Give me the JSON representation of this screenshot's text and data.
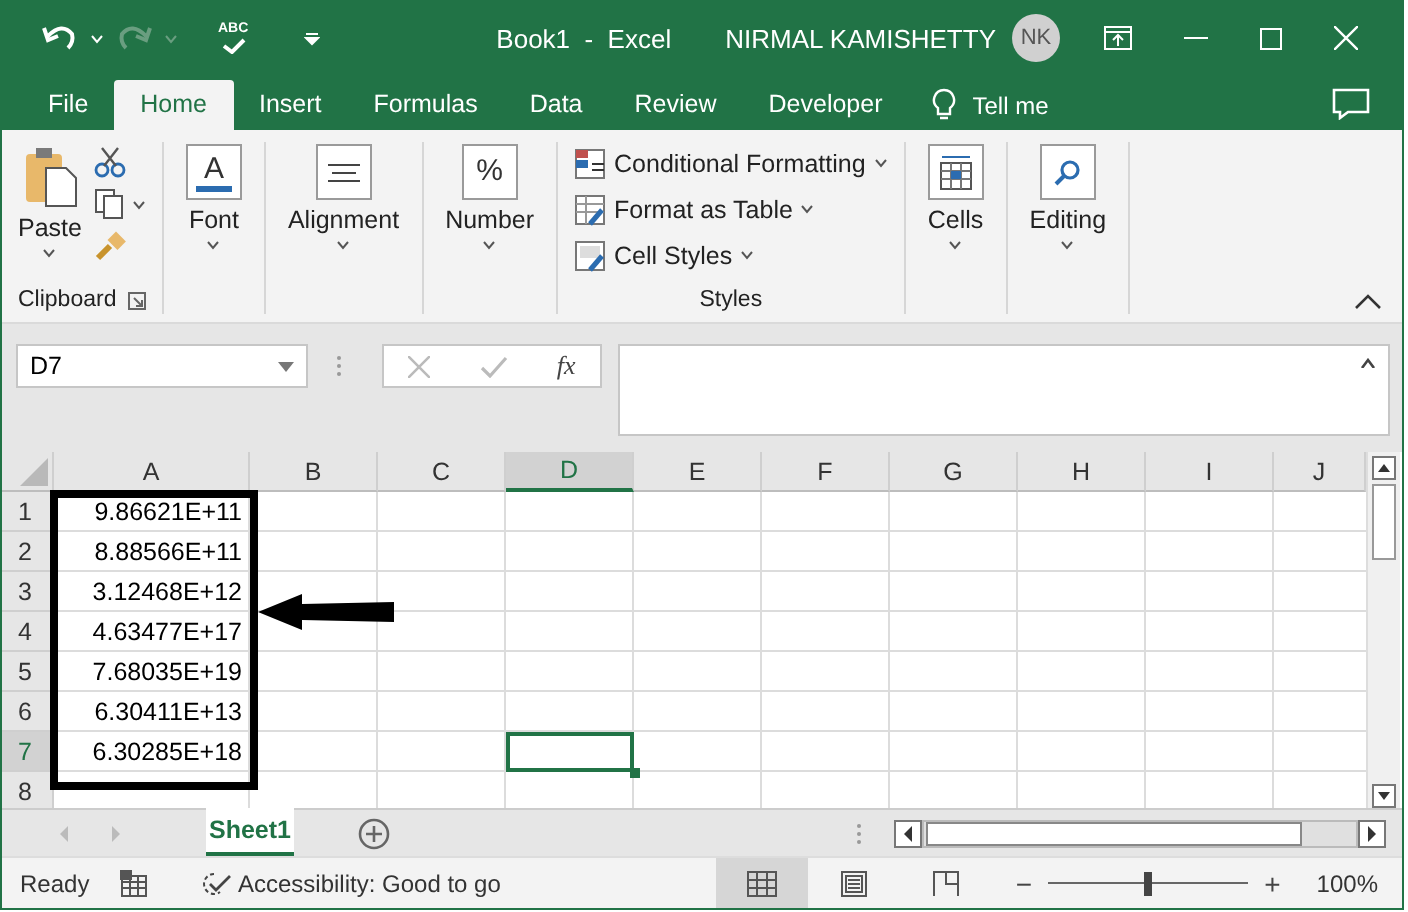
{
  "window": {
    "title": "Book1  -  Excel",
    "user": "NIRMAL KAMISHETTY",
    "avatar_initials": "NK"
  },
  "quick_access": {
    "spelling_label": "ABC"
  },
  "tabs": [
    {
      "label": "File",
      "selected": false
    },
    {
      "label": "Home",
      "selected": true
    },
    {
      "label": "Insert",
      "selected": false
    },
    {
      "label": "Formulas",
      "selected": false
    },
    {
      "label": "Data",
      "selected": false
    },
    {
      "label": "Review",
      "selected": false
    },
    {
      "label": "Developer",
      "selected": false
    }
  ],
  "tell_me": "Tell me",
  "ribbon": {
    "groups": [
      {
        "kind": "clipboard",
        "name": "Clipboard",
        "label": "Paste"
      },
      {
        "kind": "font",
        "label": "Font",
        "icon_text": "A"
      },
      {
        "kind": "alignment",
        "label": "Alignment"
      },
      {
        "kind": "number",
        "label": "Number",
        "icon_text": "%"
      },
      {
        "kind": "styles",
        "name": "Styles",
        "items": [
          "Conditional Formatting",
          "Format as Table",
          "Cell Styles"
        ]
      },
      {
        "kind": "cells",
        "label": "Cells"
      },
      {
        "kind": "editing",
        "label": "Editing"
      }
    ]
  },
  "formula_bar": {
    "name_box": "D7",
    "function_label": "fx"
  },
  "sheet": {
    "columns": [
      {
        "label": "A",
        "selected": false
      },
      {
        "label": "B",
        "selected": false
      },
      {
        "label": "C",
        "selected": false
      },
      {
        "label": "D",
        "selected": true
      },
      {
        "label": "E",
        "selected": false
      },
      {
        "label": "F",
        "selected": false
      },
      {
        "label": "G",
        "selected": false
      },
      {
        "label": "H",
        "selected": false
      },
      {
        "label": "I",
        "selected": false
      },
      {
        "label": "J",
        "selected": false
      }
    ],
    "rows": [
      {
        "header": "1",
        "selected": false,
        "values": [
          "9.86621E+11"
        ]
      },
      {
        "header": "2",
        "selected": false,
        "values": [
          "8.88566E+11"
        ]
      },
      {
        "header": "3",
        "selected": false,
        "values": [
          "3.12468E+12"
        ]
      },
      {
        "header": "4",
        "selected": false,
        "values": [
          "4.63477E+17"
        ]
      },
      {
        "header": "5",
        "selected": false,
        "values": [
          "7.68035E+19"
        ]
      },
      {
        "header": "6",
        "selected": false,
        "values": [
          "6.30411E+13"
        ]
      },
      {
        "header": "7",
        "selected": true,
        "values": [
          "6.30285E+18"
        ]
      },
      {
        "header": "8",
        "selected": false,
        "values": []
      }
    ]
  },
  "sheet_tabs": [
    {
      "label": "Sheet1",
      "selected": true
    }
  ],
  "status_bar": {
    "mode": "Ready",
    "accessibility": "Accessibility: Good to go",
    "views": [
      {
        "kind": "normal",
        "selected": true
      },
      {
        "kind": "page_layout",
        "selected": false
      },
      {
        "kind": "page_break",
        "selected": false
      }
    ],
    "zoom_out": "−",
    "zoom_in": "+",
    "zoom": {
      "level": 0.5
    },
    "zoom_label": "100%"
  }
}
